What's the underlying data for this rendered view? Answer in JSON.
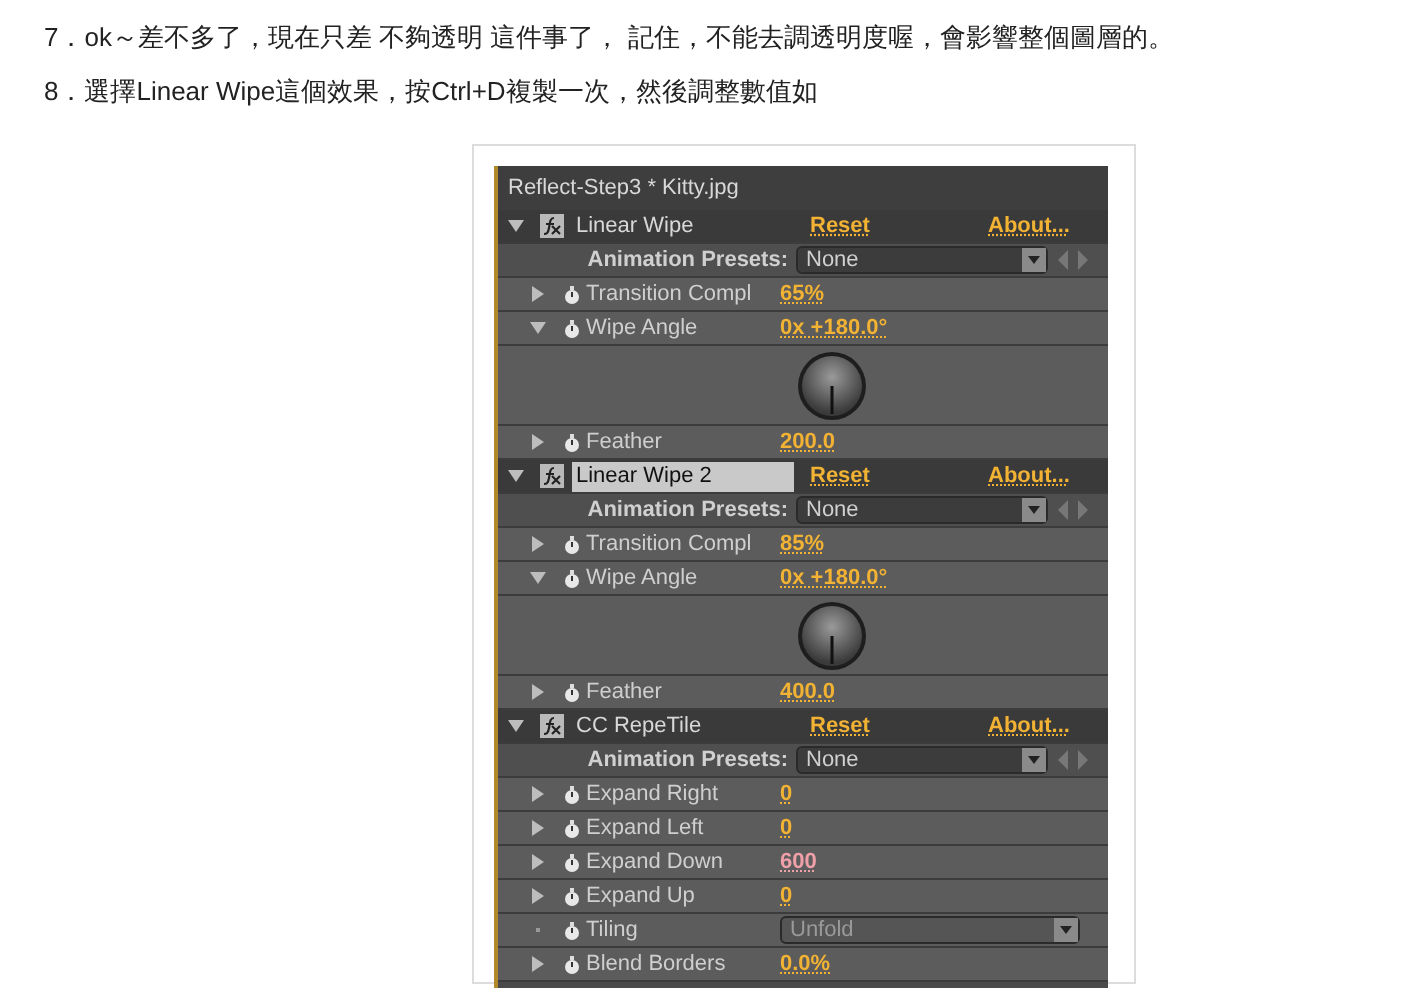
{
  "paragraphs": [
    "7．ok～差不多了，現在只差 不夠透明 這件事了， 記住，不能去調透明度喔，會影響整個圖層的。",
    "8．選擇Linear Wipe這個效果，按Ctrl+D複製一次，然後調整數值如"
  ],
  "panel": {
    "title": "Reflect-Step3 * Kitty.jpg",
    "effects": [
      {
        "name": "Linear Wipe",
        "selected": false,
        "expanded": true,
        "reset": "Reset",
        "about": "About...",
        "presets_label": "Animation Presets:",
        "preset": "None",
        "properties": [
          {
            "kind": "value",
            "label": "Transition Compl",
            "value": "65%",
            "expanded": false,
            "color": "#f2b233"
          },
          {
            "kind": "angle",
            "label": "Wipe Angle",
            "value": "0x +180.0°",
            "expanded": true,
            "color": "#f2b233"
          },
          {
            "kind": "value",
            "label": "Feather",
            "value": "200.0",
            "expanded": false,
            "color": "#f2b233"
          }
        ]
      },
      {
        "name": "Linear Wipe 2",
        "selected": true,
        "expanded": true,
        "reset": "Reset",
        "about": "About...",
        "presets_label": "Animation Presets:",
        "preset": "None",
        "properties": [
          {
            "kind": "value",
            "label": "Transition Compl",
            "value": "85%",
            "expanded": false,
            "color": "#f2b233"
          },
          {
            "kind": "angle",
            "label": "Wipe Angle",
            "value": "0x +180.0°",
            "expanded": true,
            "color": "#f2b233"
          },
          {
            "kind": "value",
            "label": "Feather",
            "value": "400.0",
            "expanded": false,
            "color": "#f2b233"
          }
        ]
      },
      {
        "name": "CC RepeTile",
        "selected": false,
        "expanded": true,
        "reset": "Reset",
        "about": "About...",
        "presets_label": "Animation Presets:",
        "preset": "None",
        "properties": [
          {
            "kind": "value",
            "label": "Expand Right",
            "value": "0",
            "expanded": false,
            "color": "#f2b233"
          },
          {
            "kind": "value",
            "label": "Expand Left",
            "value": "0",
            "expanded": false,
            "color": "#f2b233"
          },
          {
            "kind": "value",
            "label": "Expand Down",
            "value": "600",
            "expanded": false,
            "color": "#f0a0a8"
          },
          {
            "kind": "value",
            "label": "Expand Up",
            "value": "0",
            "expanded": false,
            "color": "#f2b233"
          },
          {
            "kind": "dropdown",
            "label": "Tiling",
            "value": "Unfold"
          },
          {
            "kind": "value",
            "label": "Blend Borders",
            "value": "0.0%",
            "expanded": false,
            "color": "#f2b233"
          }
        ]
      }
    ]
  }
}
